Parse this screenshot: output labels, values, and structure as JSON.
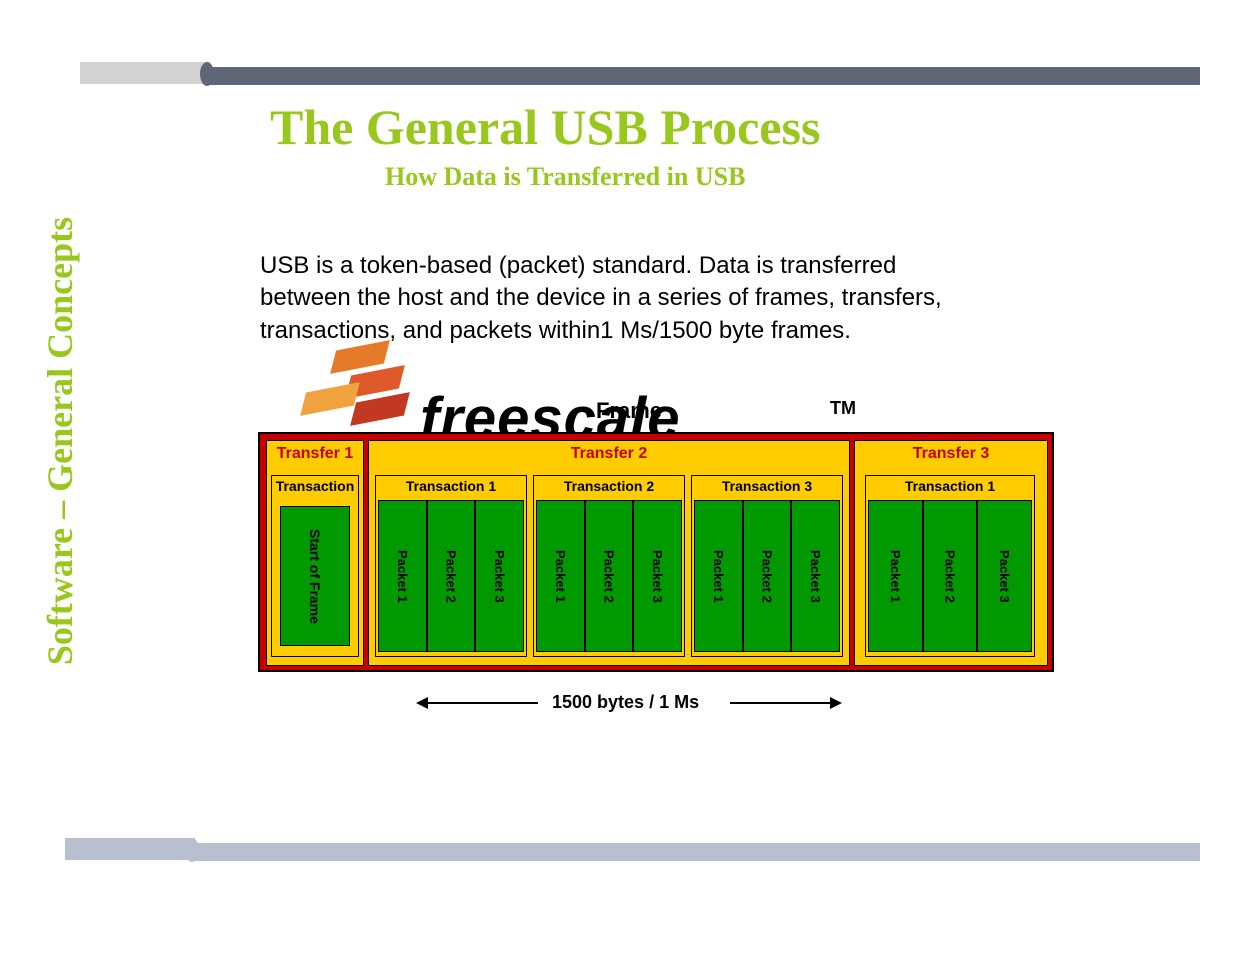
{
  "sidebar_label": "Software – General Concepts",
  "title": "The General USB Process",
  "subtitle": "How Data is Transferred in USB",
  "body_text": "USB is a token-based (packet) standard. Data is transferred between the host and the device in a series of frames, transfers, transactions, and packets within1 Ms/1500 byte frames.",
  "watermark": {
    "brand": "freescale",
    "tm": "TM"
  },
  "diagram": {
    "frame_label": "Frame",
    "span_label": "1500 bytes / 1 Ms",
    "transfers": [
      {
        "label": "Transfer 1",
        "transactions": [
          {
            "label": "Transaction",
            "start_of_frame": "Start of Frame"
          }
        ]
      },
      {
        "label": "Transfer 2",
        "transactions": [
          {
            "label": "Transaction 1",
            "packets": [
              "Packet 1",
              "Packet 2",
              "Packet 3"
            ]
          },
          {
            "label": "Transaction 2",
            "packets": [
              "Packet 1",
              "Packet 2",
              "Packet 3"
            ]
          },
          {
            "label": "Transaction 3",
            "packets": [
              "Packet 1",
              "Packet 2",
              "Packet 3"
            ]
          }
        ]
      },
      {
        "label": "Transfer 3",
        "transactions": [
          {
            "label": "Transaction 1",
            "packets": [
              "Packet 1",
              "Packet 2",
              "Packet 3"
            ]
          }
        ]
      }
    ]
  }
}
